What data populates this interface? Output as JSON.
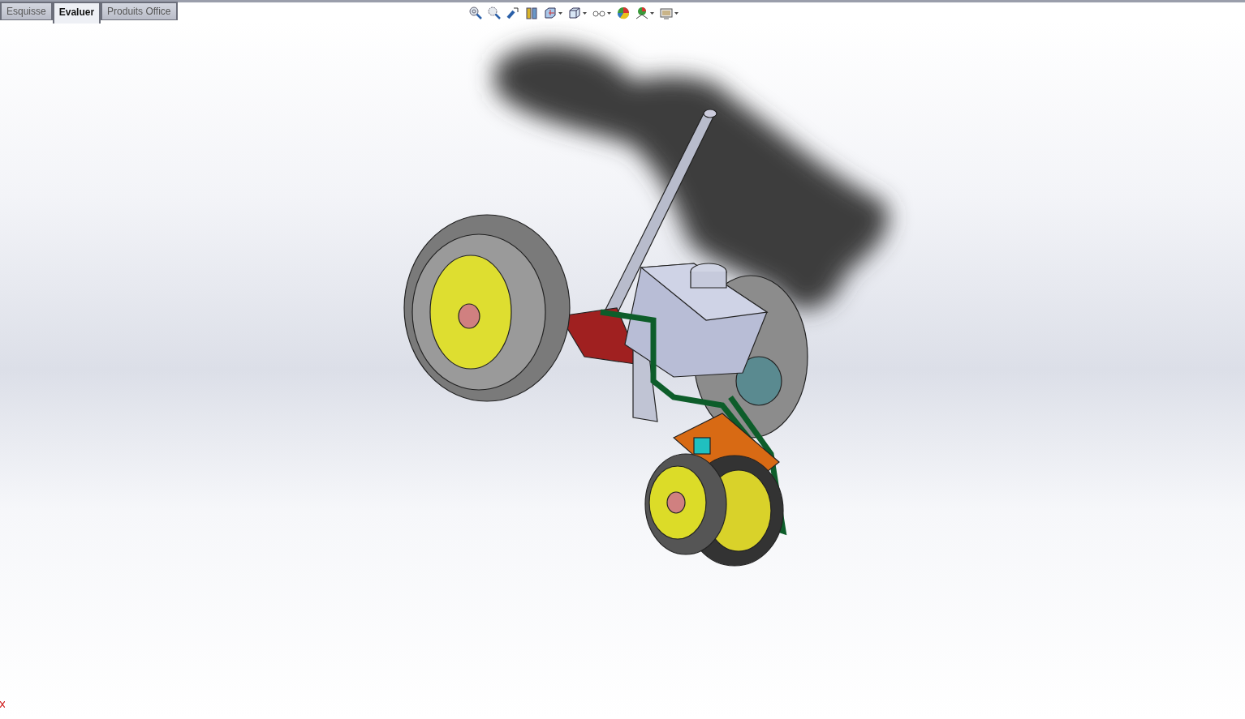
{
  "tabs": [
    {
      "label": "Esquisse",
      "selected": false
    },
    {
      "label": "Evaluer",
      "selected": true
    },
    {
      "label": "Produits Office",
      "selected": false
    }
  ]
}
